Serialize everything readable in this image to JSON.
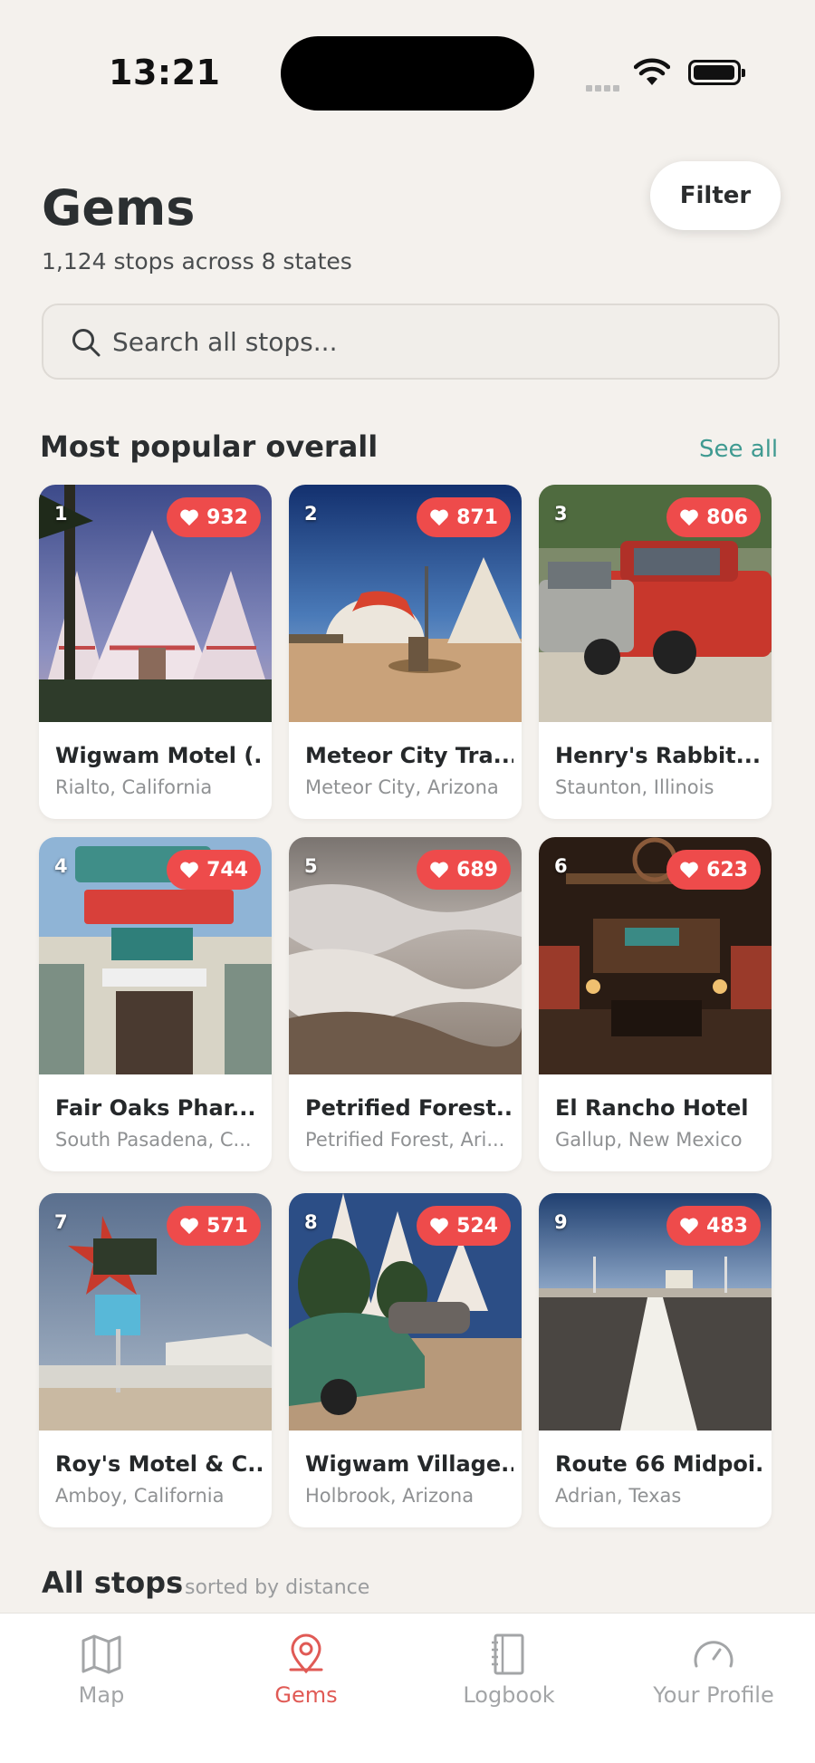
{
  "status_bar": {
    "time": "13:21"
  },
  "header": {
    "title": "Gems",
    "subtitle": "1,124 stops across 8 states",
    "filter_label": "Filter"
  },
  "search": {
    "placeholder": "Search all stops..."
  },
  "popular": {
    "title": "Most popular overall",
    "see_all": "See all",
    "items": [
      {
        "rank": "1",
        "likes": "932",
        "name": "Wigwam Motel (...",
        "location": "Rialto, California"
      },
      {
        "rank": "2",
        "likes": "871",
        "name": "Meteor City Tra...",
        "location": "Meteor City, Arizona"
      },
      {
        "rank": "3",
        "likes": "806",
        "name": "Henry's Rabbit...",
        "location": "Staunton, Illinois"
      },
      {
        "rank": "4",
        "likes": "744",
        "name": "Fair Oaks Phar...",
        "location": "South Pasadena, C..."
      },
      {
        "rank": "5",
        "likes": "689",
        "name": "Petrified Forest...",
        "location": "Petrified Forest, Ari..."
      },
      {
        "rank": "6",
        "likes": "623",
        "name": "El Rancho Hotel",
        "location": "Gallup, New Mexico"
      },
      {
        "rank": "7",
        "likes": "571",
        "name": "Roy's Motel & C...",
        "location": "Amboy, California"
      },
      {
        "rank": "8",
        "likes": "524",
        "name": "Wigwam Village...",
        "location": "Holbrook, Arizona"
      },
      {
        "rank": "9",
        "likes": "483",
        "name": "Route 66 Midpoi...",
        "location": "Adrian, Texas"
      }
    ]
  },
  "all_stops": {
    "title": "All stops",
    "sort_note": "sorted by distance"
  },
  "tabbar": {
    "tabs": [
      {
        "label": "Map",
        "icon": "map-icon",
        "active": false
      },
      {
        "label": "Gems",
        "icon": "location-pin-icon",
        "active": true
      },
      {
        "label": "Logbook",
        "icon": "notebook-icon",
        "active": false
      },
      {
        "label": "Your Profile",
        "icon": "gauge-icon",
        "active": false
      }
    ]
  },
  "colors": {
    "accent": "#ee4b4b",
    "link": "#3f9a91",
    "active_tab": "#e05a55",
    "background": "#f4f1ed"
  }
}
